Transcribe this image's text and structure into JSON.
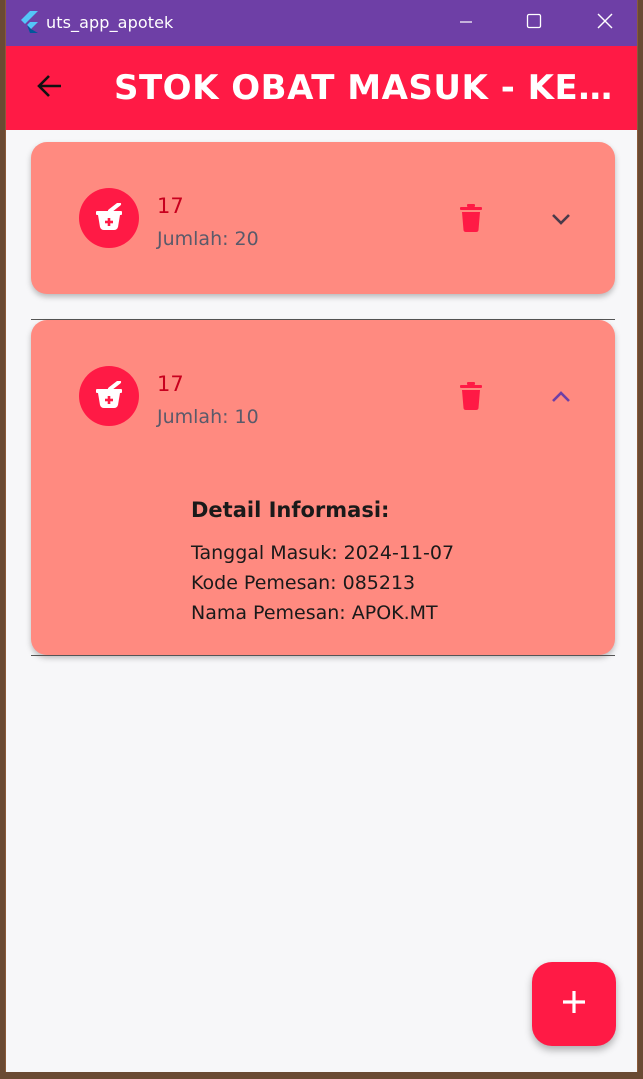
{
  "window": {
    "title": "uts_app_apotek",
    "icons": {
      "logo": "flutter-logo-icon",
      "minimize": "minimize-icon",
      "maximize": "maximize-icon",
      "close": "close-icon"
    }
  },
  "appbar": {
    "title": "STOK OBAT MASUK - KELU...",
    "back_icon": "arrow-left-icon",
    "color": "#ff1a45"
  },
  "items": [
    {
      "title": "17",
      "subtitle": "Jumlah: 20",
      "expanded": false,
      "icon": "mortar-pestle-medical-icon",
      "delete_icon": "trash-icon",
      "expand_icon": "chevron-down-icon"
    },
    {
      "title": "17",
      "subtitle": "Jumlah: 10",
      "expanded": true,
      "icon": "mortar-pestle-medical-icon",
      "delete_icon": "trash-icon",
      "expand_icon": "chevron-up-icon",
      "details": {
        "heading": "Detail Informasi:",
        "tanggal_masuk": "Tanggal Masuk: 2024-11-07",
        "kode_pemesan": "Kode Pemesan: 085213",
        "nama_pemesan": "Nama Pemesan: APOK.MT"
      }
    }
  ],
  "fab": {
    "icon": "plus-icon"
  },
  "colors": {
    "titlebar": "#6e3fa6",
    "accent": "#ff1a45",
    "card": "#ff8a80",
    "item_title": "#c8001e",
    "chevron_up": "#6e3fa6"
  }
}
